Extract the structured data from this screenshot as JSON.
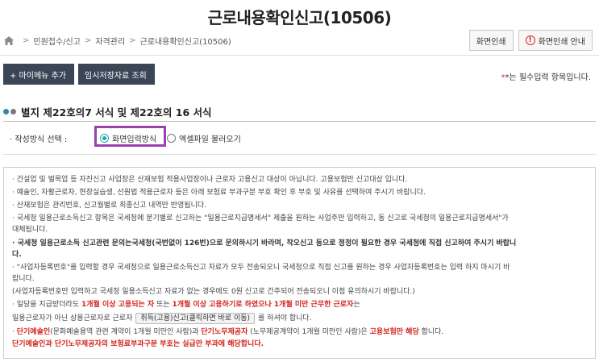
{
  "page": {
    "title": "근로내용확인신고(10506)"
  },
  "breadcrumb": {
    "items": [
      "민원접수/신고",
      "자격관리",
      "근로내용확인신고(10506)"
    ]
  },
  "top_buttons": {
    "print": "화면인쇄",
    "print_guide": "화면인쇄 안내"
  },
  "toolbar": {
    "add_menu": "+ 마이메뉴 추가",
    "temp_load": "임시저장자료 조회"
  },
  "required_note": "*는 필수입력 항목입니다.",
  "section": {
    "title": "별지 제22호의7 서식 및 제22호의 16 서식",
    "dot_colors": [
      "#2c8aa6",
      "#7a7a7a"
    ]
  },
  "form": {
    "label": "· 작성방식 선택 :",
    "option_screen": "화면입력방식",
    "option_excel": "엑셀파일 불러오기",
    "selected": "화면입력방식"
  },
  "notice": {
    "l1": "건설업 및 벌목업 등 자진신고 사업장은 산재보험 적용사업장이나 근로자 고용신고 대상이 아닙니다. 고용보험만 신고대상 입니다.",
    "l2": "예술인, 자활근로자, 현장실습생, 선원법 적용근로자 등은 아래 보험료 부과구분 부호 확인 후 부호 및 사유를 선택하여 주시기 바랍니다.",
    "l3": "산재보험은 관리번호, 신고월별로 최종신고 내역만 반영됩니다.",
    "l4": "국세청 일용근로소득신고 항목은 국세청에 분기별로 신고하는 \"일용근로지급명세서\" 제출을 원하는 사업주만 입력하고, 동 신고로 국세청의 일용근로지급명세서\"가",
    "l4b": "대체됩니다.",
    "l5": "국세청 일용근로소득 신고관련 문의는국세청(국번없이 126번)으로 문의하시기 바라며, 착오신고 등으로 정정이 필요한 경우 국세청에 직접 신고하여 주시기 바랍니",
    "l5b": "다.",
    "l6": "\"사업자등록번호\"를 입력할 경우 국세청으로 일용근로소득신고 자료가 모두 전송되오니 국세청으로 직접 신고를 원하는 경우 사업자등록번호는 입력 하지 마시기 바",
    "l6b": "랍니다.",
    "l7": "(사업자등록번호만 입력하고 국세청 일용소득신고 자료가 없는 경우에도 0원 신고로 간주되어 전송되오니 이점 유의하시기 바랍니다.)",
    "l8a": "일당을 지급받더라도 ",
    "l8b": "1개월 이상 고용되는 자",
    "l8c": " 또는 ",
    "l8d": "1개월 이상 고용하기로 하였으나 1개월 미만 근무한 근로자",
    "l8e": "는",
    "l9a": "일용근로자가 아닌 상용근로자로 근로자",
    "l9tip": "취득(고용)신고(클릭하면 바로 이동)",
    "l9b": "를 하셔야 합니다.",
    "l10a": "단기예술인",
    "l10b": "(문화예술용역 관련 계약이 1개월 미만인 사람)과 ",
    "l10c": "단기노무제공자",
    "l10d": " (노무제공계약이 1개월 미만인 사람)은 ",
    "l10e": "고용보험만 해당",
    "l10f": " 합니다.",
    "l11": "단기예술인과 단기노무제공자의 보험료부과구분 부호는 실급만 부과에 해당합니다.",
    "colors": {
      "emphasis": "#d3241c"
    }
  }
}
